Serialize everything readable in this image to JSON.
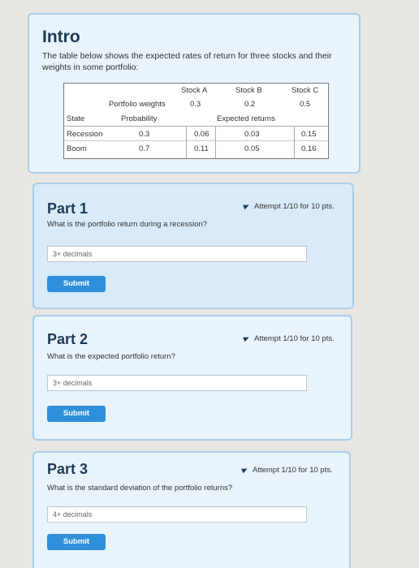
{
  "intro": {
    "title": "Intro",
    "text": "The table below shows the expected rates of return for three stocks and their weights in some portfolio:"
  },
  "table": {
    "stock_a": "Stock A",
    "stock_b": "Stock B",
    "stock_c": "Stock C",
    "portfolio_weights_label": "Portfolio weights",
    "weight_a": "0.3",
    "weight_b": "0.2",
    "weight_c": "0.5",
    "state_label": "State",
    "probability_label": "Probability",
    "expected_returns_label": "Expected returns",
    "rows": [
      {
        "state": "Recession",
        "probability": "0.3",
        "a": "0.06",
        "b": "0.03",
        "c": "0.15"
      },
      {
        "state": "Boom",
        "probability": "0.7",
        "a": "0.11",
        "b": "0.05",
        "c": "0.16"
      }
    ]
  },
  "parts": [
    {
      "title": "Part 1",
      "attempt": "Attempt 1/10 for 10 pts.",
      "question": "What is the portfolio return during a recession?",
      "placeholder": "3+ decimals",
      "submit": "Submit"
    },
    {
      "title": "Part 2",
      "attempt": "Attempt 1/10 for 10 pts.",
      "question": "What is the expected portfolio return?",
      "placeholder": "3+ decimals",
      "submit": "Submit"
    },
    {
      "title": "Part 3",
      "attempt": "Attempt 1/10 for 10 pts.",
      "question": "What is the standard deviation of the portfolio returns?",
      "placeholder": "4+ decimals",
      "submit": "Submit"
    }
  ]
}
